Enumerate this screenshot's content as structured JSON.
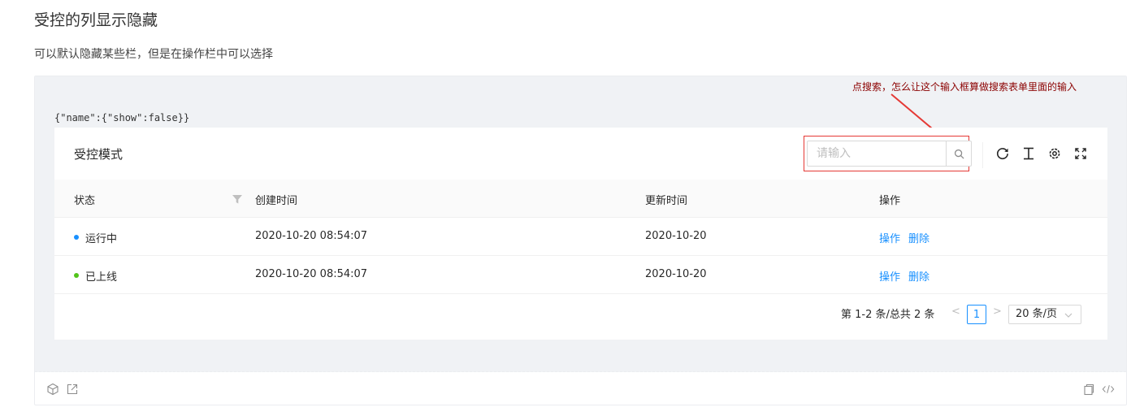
{
  "page": {
    "title": "受控的列显示隐藏",
    "description": "可以默认隐藏某些栏，但是在操作栏中可以选择"
  },
  "demo": {
    "json_state": "{\"name\":{\"show\":false}}",
    "annotation": "点搜索，怎么让这个输入框算做搜索表单里面的输入",
    "card_title": "受控模式",
    "search": {
      "placeholder": "请输入"
    },
    "toolbar": {
      "icons": [
        "reload-icon",
        "density-icon",
        "setting-icon",
        "fullscreen-icon"
      ]
    },
    "table": {
      "columns": [
        "状态",
        "创建时间",
        "更新时间",
        "操作"
      ],
      "rows": [
        {
          "status": "运行中",
          "status_color": "#1890ff",
          "created": "2020-10-20 08:54:07",
          "updated": "2020-10-20",
          "action1": "操作",
          "action2": "删除"
        },
        {
          "status": "已上线",
          "status_color": "#52c41a",
          "created": "2020-10-20 08:54:07",
          "updated": "2020-10-20",
          "action1": "操作",
          "action2": "删除"
        }
      ]
    },
    "pagination": {
      "summary": "第 1-2 条/总共 2 条",
      "prev": "<",
      "current": "1",
      "next": ">",
      "page_size": "20 条/页"
    }
  },
  "colors": {
    "accent": "#1890ff",
    "highlight": "#e53935",
    "annotation": "#8b0000"
  }
}
